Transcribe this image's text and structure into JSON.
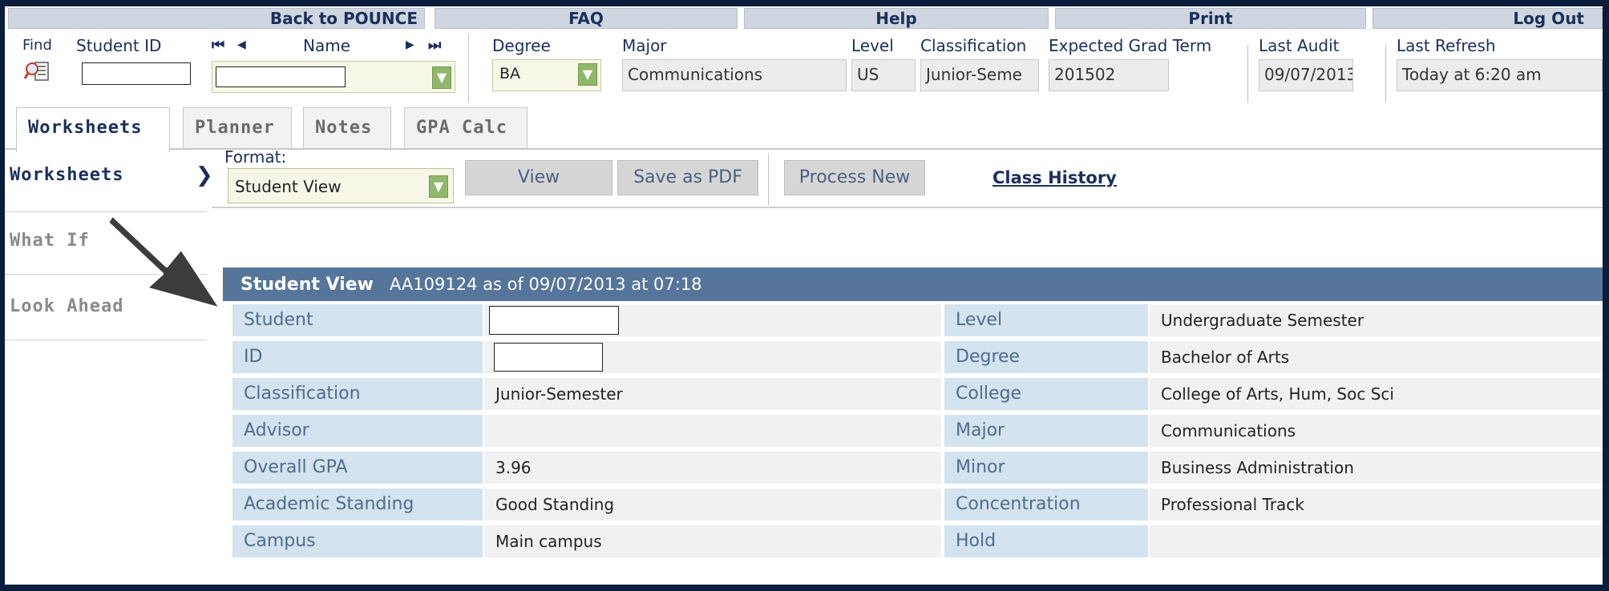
{
  "topnav": {
    "back_label": "Back to POUNCE",
    "faq_label": "FAQ",
    "help_label": "Help",
    "print_label": "Print",
    "logout_label": "Log Out"
  },
  "header": {
    "find_label": "Find",
    "student_id_label": "Student ID",
    "name_label": "Name",
    "degree_label": "Degree",
    "degree_value": "BA",
    "major_label": "Major",
    "major_value": "Communications",
    "level_label": "Level",
    "level_value": "US",
    "classification_label": "Classification",
    "classification_value": "Junior-Seme",
    "grad_term_label": "Expected Grad Term",
    "grad_term_value": "201502",
    "last_audit_label": "Last Audit",
    "last_audit_value": "09/07/2013",
    "last_refresh_label": "Last Refresh",
    "last_refresh_value": "Today at 6:20 am",
    "nav_first": "⏮",
    "nav_prev": "◀",
    "nav_next": "▶",
    "nav_last": "⏭"
  },
  "tabs": [
    {
      "label": "Worksheets",
      "active": true
    },
    {
      "label": "Planner",
      "active": false
    },
    {
      "label": "Notes",
      "active": false
    },
    {
      "label": "GPA Calc",
      "active": false
    }
  ],
  "leftnav": {
    "worksheets": "Worksheets",
    "what_if": "What If",
    "look_ahead": "Look Ahead",
    "chevron": "❯"
  },
  "toolbar": {
    "format_label": "Format:",
    "format_value": "Student View",
    "view_label": "View",
    "save_pdf_label": "Save as PDF",
    "process_new_label": "Process New",
    "class_history_label": "Class History"
  },
  "student_view": {
    "title": "Student View",
    "subtitle": "AA109124 as of 09/07/2013 at 07:18",
    "left_rows": [
      {
        "label": "Student",
        "value": ""
      },
      {
        "label": "ID",
        "value": ""
      },
      {
        "label": "Classification",
        "value": "Junior-Semester"
      },
      {
        "label": "Advisor",
        "value": ""
      },
      {
        "label": "Overall GPA",
        "value": "3.96"
      },
      {
        "label": "Academic Standing",
        "value": "Good Standing"
      },
      {
        "label": "Campus",
        "value": "Main campus"
      }
    ],
    "right_rows": [
      {
        "label": "Level",
        "value": "Undergraduate Semester"
      },
      {
        "label": "Degree",
        "value": "Bachelor of Arts"
      },
      {
        "label": "College",
        "value": "College of Arts, Hum, Soc Sci"
      },
      {
        "label": "Major",
        "value": "Communications"
      },
      {
        "label": "Minor",
        "value": "Business Administration"
      },
      {
        "label": "Concentration",
        "value": "Professional Track"
      },
      {
        "label": "Hold",
        "value": ""
      }
    ]
  },
  "colors": {
    "header_bar": "#55769a",
    "label_bg": "#d3e3ef",
    "label_text": "#4f6c8c",
    "nav_text": "#1b2f5c",
    "outer_frame": "#0a1d3d"
  },
  "icons": {
    "find": "magnifier-list-icon",
    "arrow": "annotation-arrow-icon"
  }
}
